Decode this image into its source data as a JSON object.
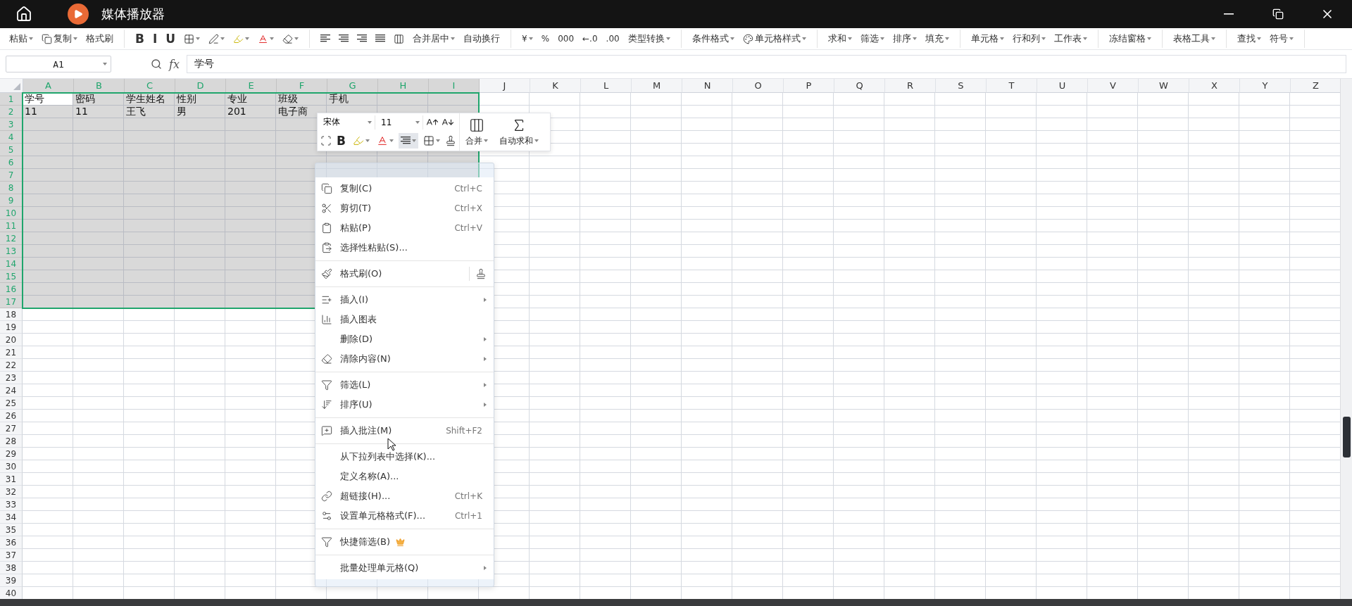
{
  "window": {
    "title": "媒体播放器"
  },
  "toolbar": [
    {
      "kind": "text",
      "label": "粘贴",
      "dropdown": true
    },
    {
      "kind": "icon-text",
      "label": "复制",
      "dropdown": true
    },
    {
      "kind": "text",
      "label": "格式刷",
      "dropdown": false
    },
    {
      "kind": "separator"
    },
    {
      "kind": "glyph",
      "label": "B",
      "dropdown": false
    },
    {
      "kind": "glyph",
      "label": "I",
      "dropdown": false
    },
    {
      "kind": "glyph",
      "label": "U",
      "dropdown": false
    },
    {
      "kind": "icon",
      "dropdown": true
    },
    {
      "kind": "icon",
      "dropdown": true
    },
    {
      "kind": "icon",
      "dropdown": true
    },
    {
      "kind": "icon",
      "dropdown": true
    },
    {
      "kind": "icon",
      "dropdown": true
    },
    {
      "kind": "separator"
    },
    {
      "kind": "icon",
      "dropdown": false
    },
    {
      "kind": "icon",
      "dropdown": false
    },
    {
      "kind": "icon",
      "dropdown": false
    },
    {
      "kind": "icon",
      "dropdown": false
    },
    {
      "kind": "icon",
      "dropdown": false
    },
    {
      "kind": "text",
      "label": "合并居中",
      "dropdown": true
    },
    {
      "kind": "text",
      "label": "自动换行",
      "dropdown": false
    },
    {
      "kind": "separator"
    },
    {
      "kind": "glyph",
      "label": "¥",
      "dropdown": true
    },
    {
      "kind": "glyph",
      "label": "%",
      "dropdown": false
    },
    {
      "kind": "glyph",
      "label": "000",
      "dropdown": false
    },
    {
      "kind": "glyph",
      "label": "←.0",
      "dropdown": false
    },
    {
      "kind": "glyph",
      "label": ".00",
      "dropdown": false
    },
    {
      "kind": "text",
      "label": "类型转换",
      "dropdown": true
    },
    {
      "kind": "separator"
    },
    {
      "kind": "text",
      "label": "条件格式",
      "dropdown": true
    },
    {
      "kind": "icon-text",
      "label": "单元格样式",
      "dropdown": true
    },
    {
      "kind": "separator"
    },
    {
      "kind": "text",
      "label": "求和",
      "dropdown": true
    },
    {
      "kind": "text",
      "label": "筛选",
      "dropdown": true
    },
    {
      "kind": "text",
      "label": "排序",
      "dropdown": true
    },
    {
      "kind": "text",
      "label": "填充",
      "dropdown": true
    },
    {
      "kind": "separator"
    },
    {
      "kind": "text",
      "label": "单元格",
      "dropdown": true
    },
    {
      "kind": "text",
      "label": "行和列",
      "dropdown": true
    },
    {
      "kind": "text",
      "label": "工作表",
      "dropdown": true
    },
    {
      "kind": "separator"
    },
    {
      "kind": "text",
      "label": "冻结窗格",
      "dropdown": true
    },
    {
      "kind": "separator"
    },
    {
      "kind": "text",
      "label": "表格工具",
      "dropdown": true
    },
    {
      "kind": "separator"
    },
    {
      "kind": "text",
      "label": "查找",
      "dropdown": true
    },
    {
      "kind": "text",
      "label": "符号",
      "dropdown": true
    },
    {
      "kind": "separator"
    }
  ],
  "formula_bar": {
    "name_box": "A1",
    "fx": "fx",
    "value": "学号"
  },
  "sheet": {
    "columns": [
      {
        "label": "A",
        "selected": true
      },
      {
        "label": "B",
        "selected": true
      },
      {
        "label": "C",
        "selected": true
      },
      {
        "label": "D",
        "selected": true
      },
      {
        "label": "E",
        "selected": true
      },
      {
        "label": "F",
        "selected": true
      },
      {
        "label": "G",
        "selected": true
      },
      {
        "label": "H",
        "selected": true
      },
      {
        "label": "I",
        "selected": true
      },
      {
        "label": "J",
        "selected": false
      },
      {
        "label": "K",
        "selected": false
      },
      {
        "label": "L",
        "selected": false
      },
      {
        "label": "M",
        "selected": false
      },
      {
        "label": "N",
        "selected": false
      },
      {
        "label": "O",
        "selected": false
      },
      {
        "label": "P",
        "selected": false
      },
      {
        "label": "Q",
        "selected": false
      },
      {
        "label": "R",
        "selected": false
      },
      {
        "label": "S",
        "selected": false
      },
      {
        "label": "T",
        "selected": false
      },
      {
        "label": "U",
        "selected": false
      },
      {
        "label": "V",
        "selected": false
      },
      {
        "label": "W",
        "selected": false
      },
      {
        "label": "X",
        "selected": false
      },
      {
        "label": "Y",
        "selected": false
      },
      {
        "label": "Z",
        "selected": false
      }
    ],
    "rows": [
      {
        "label": "1",
        "selected": true,
        "cells": [
          {
            "text": "学号",
            "active": true
          },
          {
            "text": "密码",
            "active": false
          },
          {
            "text": "学生姓名",
            "active": false
          },
          {
            "text": "性别",
            "active": false
          },
          {
            "text": "专业",
            "active": false
          },
          {
            "text": "班级",
            "active": false
          },
          {
            "text": "手机",
            "active": false
          }
        ]
      },
      {
        "label": "2",
        "selected": true,
        "cells": [
          {
            "text": "11",
            "active": false
          },
          {
            "text": "11",
            "active": false
          },
          {
            "text": "王飞",
            "active": false
          },
          {
            "text": "男",
            "active": false
          },
          {
            "text": "201",
            "active": false
          },
          {
            "text": "电子商",
            "active": false
          }
        ]
      },
      {
        "label": "3",
        "selected": true
      },
      {
        "label": "4",
        "selected": true
      },
      {
        "label": "5",
        "selected": true
      },
      {
        "label": "6",
        "selected": true
      },
      {
        "label": "7",
        "selected": true
      },
      {
        "label": "8",
        "selected": true
      },
      {
        "label": "9",
        "selected": true
      },
      {
        "label": "10",
        "selected": true
      },
      {
        "label": "11",
        "selected": true
      },
      {
        "label": "12",
        "selected": true
      },
      {
        "label": "13",
        "selected": true
      },
      {
        "label": "14",
        "selected": true
      },
      {
        "label": "15",
        "selected": true
      },
      {
        "label": "16",
        "selected": true
      },
      {
        "label": "17",
        "selected": true
      },
      {
        "label": "18",
        "selected": false
      },
      {
        "label": "19",
        "selected": false
      },
      {
        "label": "20",
        "selected": false
      },
      {
        "label": "21",
        "selected": false
      },
      {
        "label": "22",
        "selected": false
      },
      {
        "label": "23",
        "selected": false
      },
      {
        "label": "24",
        "selected": false
      },
      {
        "label": "25",
        "selected": false
      },
      {
        "label": "26",
        "selected": false
      },
      {
        "label": "27",
        "selected": false
      },
      {
        "label": "28",
        "selected": false
      },
      {
        "label": "29",
        "selected": false
      },
      {
        "label": "30",
        "selected": false
      },
      {
        "label": "31",
        "selected": false
      },
      {
        "label": "32",
        "selected": false
      },
      {
        "label": "33",
        "selected": false
      },
      {
        "label": "34",
        "selected": false
      },
      {
        "label": "35",
        "selected": false
      },
      {
        "label": "36",
        "selected": false
      },
      {
        "label": "37",
        "selected": false
      },
      {
        "label": "38",
        "selected": false
      },
      {
        "label": "39",
        "selected": false
      },
      {
        "label": "40",
        "selected": false
      }
    ]
  },
  "mini_toolbar": {
    "font": "宋体",
    "size": "11",
    "bold": "B",
    "align_selected": true,
    "merge": "合并",
    "autosum": "自动求和"
  },
  "context_menu": [
    {
      "kind": "item",
      "label": "复制(C)",
      "shortcut": "Ctrl+C",
      "submenu": false
    },
    {
      "kind": "item",
      "label": "剪切(T)",
      "shortcut": "Ctrl+X",
      "submenu": false
    },
    {
      "kind": "item",
      "label": "粘贴(P)",
      "shortcut": "Ctrl+V",
      "submenu": false
    },
    {
      "kind": "item",
      "label": "选择性粘贴(S)...",
      "submenu": false
    },
    {
      "kind": "separator"
    },
    {
      "kind": "item",
      "label": "格式刷(O)",
      "submenu": false,
      "side_button": true
    },
    {
      "kind": "separator"
    },
    {
      "kind": "item",
      "label": "插入(I)",
      "submenu": true
    },
    {
      "kind": "item",
      "label": "插入图表",
      "submenu": false
    },
    {
      "kind": "item",
      "label": "删除(D)",
      "submenu": true
    },
    {
      "kind": "item",
      "label": "清除内容(N)",
      "submenu": true
    },
    {
      "kind": "separator"
    },
    {
      "kind": "item",
      "label": "筛选(L)",
      "submenu": true
    },
    {
      "kind": "item",
      "label": "排序(U)",
      "submenu": true
    },
    {
      "kind": "separator"
    },
    {
      "kind": "item",
      "label": "插入批注(M)",
      "shortcut": "Shift+F2",
      "submenu": false
    },
    {
      "kind": "separator"
    },
    {
      "kind": "item",
      "label": "从下拉列表中选择(K)...",
      "submenu": false
    },
    {
      "kind": "item",
      "label": "定义名称(A)...",
      "submenu": false
    },
    {
      "kind": "item",
      "label": "超链接(H)...",
      "shortcut": "Ctrl+K",
      "submenu": false
    },
    {
      "kind": "item",
      "label": "设置单元格格式(F)...",
      "shortcut": "Ctrl+1",
      "submenu": false
    },
    {
      "kind": "separator"
    },
    {
      "kind": "item",
      "label": "快捷筛选(B)",
      "submenu": false,
      "premium": true
    },
    {
      "kind": "separator"
    },
    {
      "kind": "item",
      "label": "批量处理单元格(Q)",
      "submenu": true
    }
  ]
}
